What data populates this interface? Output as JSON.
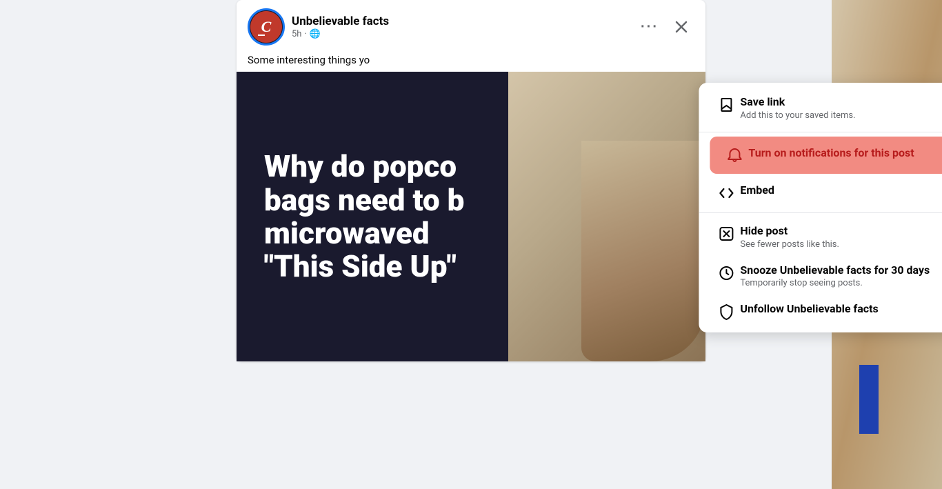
{
  "page": {
    "bg_color": "#f0f2f5"
  },
  "post": {
    "page_name": "Unbelievable facts",
    "time": "5h",
    "time_globe": "🌐",
    "text": "Some interesting things yo",
    "image_text_line1": "Why do popco",
    "image_text_line2": "bags need to b",
    "image_text_line3": "microwaved",
    "image_text_line4": "\"This Side Up\"",
    "more_btn_label": "···",
    "close_btn_label": "✕",
    "avatar_letter": "𝑪"
  },
  "dropdown": {
    "save_link": {
      "title": "Save link",
      "subtitle": "Add this to your saved items."
    },
    "notifications": {
      "title": "Turn on notifications for this post"
    },
    "embed": {
      "title": "Embed"
    },
    "hide_post": {
      "title": "Hide post",
      "subtitle": "See fewer posts like this."
    },
    "snooze": {
      "title": "Snooze Unbelievable facts for 30 days",
      "subtitle": "Temporarily stop seeing posts."
    },
    "unfollow": {
      "title": "Unfollow Unbelievable facts"
    }
  }
}
